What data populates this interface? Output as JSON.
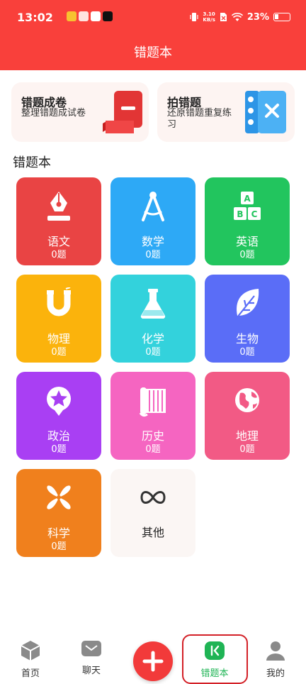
{
  "status_bar": {
    "time": "13:02",
    "net_speed_value": "3.10",
    "net_speed_unit": "KB/s",
    "battery": "23%"
  },
  "header": {
    "title": "错题本"
  },
  "cards": [
    {
      "title": "错题成卷",
      "subtitle": "整理错题成试卷"
    },
    {
      "title": "拍错题",
      "subtitle_line1": "还原错题重复练",
      "subtitle_line2": "习"
    }
  ],
  "section_title": "错题本",
  "subjects": [
    {
      "name": "语文",
      "count": "0题",
      "icon": "pen-nib-icon",
      "color": "#e94444"
    },
    {
      "name": "数学",
      "count": "0题",
      "icon": "compass-icon",
      "color": "#2da9f6"
    },
    {
      "name": "英语",
      "count": "0题",
      "icon": "abc-blocks-icon",
      "color": "#22c55e"
    },
    {
      "name": "物理",
      "count": "0题",
      "icon": "magnet-icon",
      "color": "#fbb30c"
    },
    {
      "name": "化学",
      "count": "0题",
      "icon": "flask-icon",
      "color": "#33d2dc"
    },
    {
      "name": "生物",
      "count": "0题",
      "icon": "leaf-icon",
      "color": "#5a6df7"
    },
    {
      "name": "政治",
      "count": "0题",
      "icon": "star-badge-icon",
      "color": "#a93ff3"
    },
    {
      "name": "历史",
      "count": "0题",
      "icon": "scroll-icon",
      "color": "#f565c1"
    },
    {
      "name": "地理",
      "count": "0题",
      "icon": "globe-icon",
      "color": "#f25a85"
    },
    {
      "name": "科学",
      "count": "0题",
      "icon": "atom-star-icon",
      "color": "#f0801d"
    }
  ],
  "other": {
    "name": "其他",
    "icon": "infinity-icon"
  },
  "tabs": [
    {
      "label": "首页",
      "icon": "home-cube-icon"
    },
    {
      "label": "聊天",
      "icon": "chat-icon"
    },
    {
      "label": "错题本",
      "icon": "mistake-book-icon",
      "active": true
    },
    {
      "label": "我的",
      "icon": "profile-icon"
    }
  ],
  "colors": {
    "header": "#f9403b",
    "active_tab": "#1fb455",
    "highlight": "#d32027"
  }
}
